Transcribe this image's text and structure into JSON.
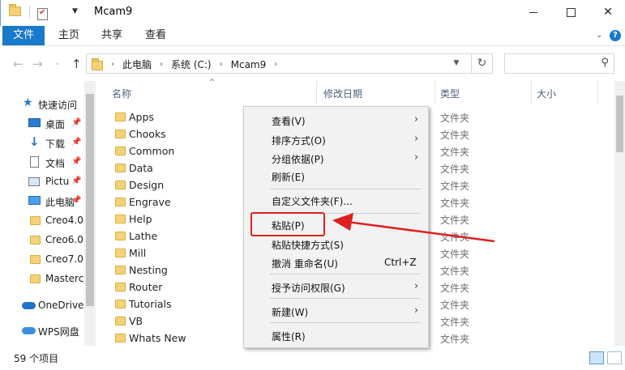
{
  "window": {
    "title": "Mcam9",
    "minimize": "minimize",
    "maximize": "maximize",
    "close": "✕"
  },
  "ribbon": {
    "tabs": [
      "文件",
      "主页",
      "共享",
      "查看"
    ]
  },
  "address": {
    "crumbs": [
      "此电脑",
      "系统 (C:)",
      "Mcam9"
    ],
    "search_placeholder": ""
  },
  "nav": {
    "items": [
      {
        "label": "快速访问",
        "icon": "star-icon"
      },
      {
        "label": "桌面",
        "icon": "desktop-icon",
        "pinned": true
      },
      {
        "label": "下载",
        "icon": "download-icon",
        "pinned": true
      },
      {
        "label": "文档",
        "icon": "documents-icon",
        "pinned": true
      },
      {
        "label": "Pictu",
        "icon": "pictures-icon",
        "pinned": true
      },
      {
        "label": "此电脑",
        "icon": "computer-icon",
        "pinned": true
      },
      {
        "label": "Creo4.0",
        "icon": "folder-icon"
      },
      {
        "label": "Creo6.0",
        "icon": "folder-icon"
      },
      {
        "label": "Creo7.0",
        "icon": "folder-icon"
      },
      {
        "label": "Mastercam",
        "icon": "folder-icon"
      },
      {
        "label": "OneDrive",
        "icon": "onedrive-icon"
      },
      {
        "label": "WPS网盘",
        "icon": "wps-cloud-icon"
      }
    ]
  },
  "columns": {
    "name": "名称",
    "modified": "修改日期",
    "type": "类型",
    "size": "大小"
  },
  "files": [
    {
      "name": "Apps",
      "type": "文件夹"
    },
    {
      "name": "Chooks",
      "type": "文件夹"
    },
    {
      "name": "Common",
      "type": "文件夹"
    },
    {
      "name": "Data",
      "type": "文件夹"
    },
    {
      "name": "Design",
      "type": "文件夹"
    },
    {
      "name": "Engrave",
      "type": "文件夹"
    },
    {
      "name": "Help",
      "type": "文件夹"
    },
    {
      "name": "Lathe",
      "type": "文件夹"
    },
    {
      "name": "Mill",
      "type": "文件夹"
    },
    {
      "name": "Nesting",
      "type": "文件夹"
    },
    {
      "name": "Router",
      "type": "文件夹"
    },
    {
      "name": "Tutorials",
      "type": "文件夹"
    },
    {
      "name": "VB",
      "type": "文件夹"
    },
    {
      "name": "Whats New",
      "type": "文件夹"
    }
  ],
  "status": {
    "count": "59 个项目"
  },
  "context_menu": {
    "view": "查看(V)",
    "sort": "排序方式(O)",
    "group": "分组依据(P)",
    "refresh": "刷新(E)",
    "customize": "自定义文件夹(F)...",
    "paste": "粘贴(P)",
    "paste_shortcut": "粘贴快捷方式(S)",
    "undo": "撤消 重命名(U)",
    "undo_shortcut": "Ctrl+Z",
    "grant_access": "授予访问权限(G)",
    "new": "新建(W)",
    "properties": "属性(R)"
  },
  "colors": {
    "accent": "#1979ca",
    "annotation": "#e02020"
  }
}
